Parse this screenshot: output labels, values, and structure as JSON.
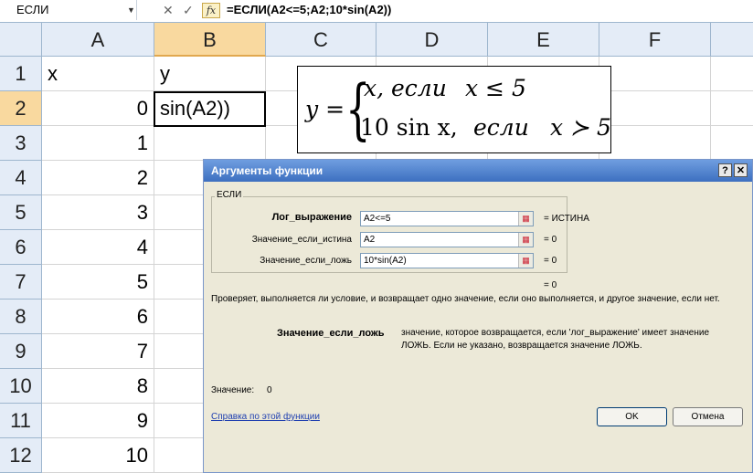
{
  "formula_bar": {
    "name_box": "ЕСЛИ",
    "cancel_glyph": "✕",
    "enter_glyph": "✓",
    "fx_label": "fx",
    "formula": "=ЕСЛИ(A2<=5;A2;10*sin(A2))"
  },
  "columns": [
    "A",
    "B",
    "C",
    "D",
    "E",
    "F"
  ],
  "rows": [
    "1",
    "2",
    "3",
    "4",
    "5",
    "6",
    "7",
    "8",
    "9",
    "10",
    "11",
    "12"
  ],
  "cells": {
    "A1": "x",
    "B1": "y",
    "B2": "sin(A2))",
    "A_values": [
      "0",
      "1",
      "2",
      "3",
      "4",
      "5",
      "6",
      "7",
      "8",
      "9",
      "10"
    ]
  },
  "formula_image": {
    "y_eq": "y =",
    "brace": "{",
    "line1_a": "x, если",
    "line1_b": "x ≤ 5",
    "line2_a": "10 sin x,",
    "line2_b": "если",
    "line2_c": "x ≻ 5"
  },
  "dialog": {
    "title": "Аргументы функции",
    "help_glyph": "?",
    "close_glyph": "✕",
    "group_title": "ЕСЛИ",
    "args": [
      {
        "label": "Лог_выражение",
        "value": "A2<=5",
        "result": "=  ИСТИНА"
      },
      {
        "label": "Значение_если_истина",
        "value": "A2",
        "result": "=  0"
      },
      {
        "label": "Значение_если_ложь",
        "value": "10*sin(A2)",
        "result": "=  0"
      }
    ],
    "overall_result": "=  0",
    "description": "Проверяет, выполняется ли условие, и возвращает одно значение, если оно выполняется, и другое значение, если нет.",
    "arg_name": "Значение_если_ложь",
    "arg_desc_1": "значение, которое возвращается, если 'лог_выражение' имеет значение",
    "arg_desc_2": "ЛОЖЬ. Если не указано, возвращается значение ЛОЖЬ.",
    "value_label": "Значение:",
    "value": "0",
    "help_link": "Справка по этой функции",
    "ok": "OK",
    "cancel": "Отмена"
  }
}
